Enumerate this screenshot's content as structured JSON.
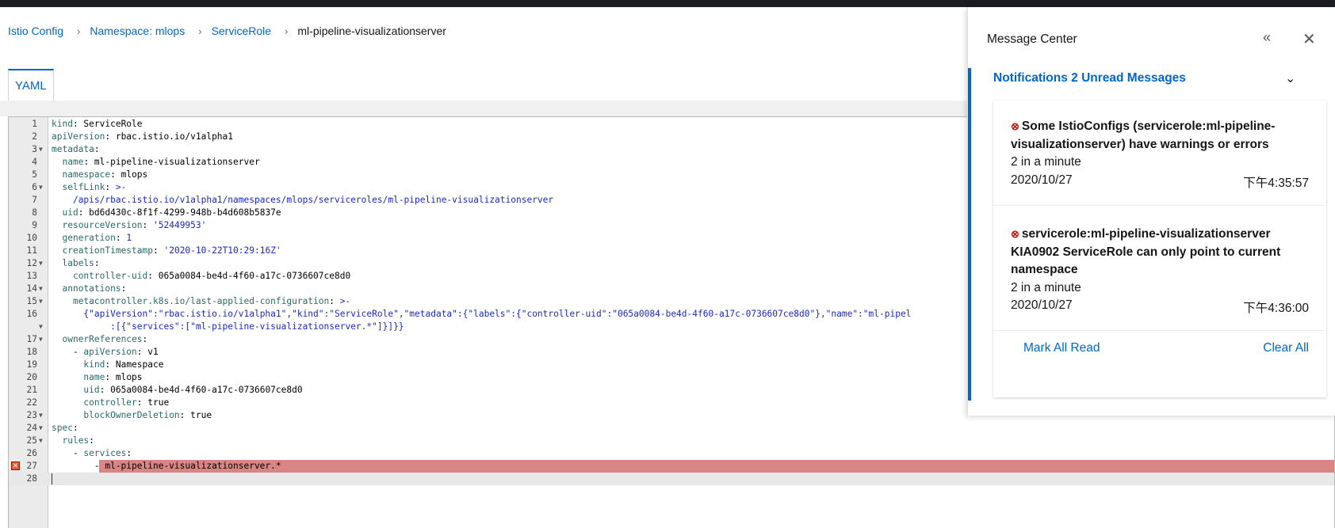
{
  "breadcrumb": {
    "items": [
      "Istio Config",
      "Namespace: mlops",
      "ServiceRole"
    ],
    "current": "ml-pipeline-visualizationserver",
    "separator": "›"
  },
  "tabs": [
    {
      "label": "YAML"
    }
  ],
  "editor": {
    "lines": [
      [
        {
          "t": "kind",
          "c": "k"
        },
        {
          "t": ": ServiceRole"
        }
      ],
      [
        {
          "t": "apiVersion",
          "c": "k"
        },
        {
          "t": ": rbac.istio.io/v1alpha1"
        }
      ],
      [
        {
          "t": "metadata",
          "c": "k"
        },
        {
          "t": ":"
        }
      ],
      [
        {
          "t": "  "
        },
        {
          "t": "name",
          "c": "k"
        },
        {
          "t": ": ml-pipeline-visualizationserver"
        }
      ],
      [
        {
          "t": "  "
        },
        {
          "t": "namespace",
          "c": "k"
        },
        {
          "t": ": mlops"
        }
      ],
      [
        {
          "t": "  "
        },
        {
          "t": "selfLink",
          "c": "k"
        },
        {
          "t": ": "
        },
        {
          "t": ">-",
          "c": "s"
        }
      ],
      [
        {
          "t": "    "
        },
        {
          "t": "/apis/rbac.istio.io/v1alpha1/namespaces/mlops/serviceroles/ml-pipeline-visualizationserver",
          "c": "s"
        }
      ],
      [
        {
          "t": "  "
        },
        {
          "t": "uid",
          "c": "k"
        },
        {
          "t": ": bd6d430c-8f1f-4299-948b-b4d608b5837e"
        }
      ],
      [
        {
          "t": "  "
        },
        {
          "t": "resourceVersion",
          "c": "k"
        },
        {
          "t": ": "
        },
        {
          "t": "'52449953'",
          "c": "s"
        }
      ],
      [
        {
          "t": "  "
        },
        {
          "t": "generation",
          "c": "k"
        },
        {
          "t": ": "
        },
        {
          "t": "1",
          "c": "n"
        }
      ],
      [
        {
          "t": "  "
        },
        {
          "t": "creationTimestamp",
          "c": "k"
        },
        {
          "t": ": "
        },
        {
          "t": "'2020-10-22T10:29:16Z'",
          "c": "s"
        }
      ],
      [
        {
          "t": "  "
        },
        {
          "t": "labels",
          "c": "k"
        },
        {
          "t": ":"
        }
      ],
      [
        {
          "t": "    "
        },
        {
          "t": "controller-uid",
          "c": "k"
        },
        {
          "t": ": 065a0084-be4d-4f60-a17c-0736607ce8d0"
        }
      ],
      [
        {
          "t": "  "
        },
        {
          "t": "annotations",
          "c": "k"
        },
        {
          "t": ":"
        }
      ],
      [
        {
          "t": "    "
        },
        {
          "t": "metacontroller.k8s.io/last-applied-configuration",
          "c": "k"
        },
        {
          "t": ": "
        },
        {
          "t": ">-",
          "c": "s"
        }
      ],
      [
        {
          "t": "      "
        },
        {
          "t": "{\"apiVersion\":\"rbac.istio.io/v1alpha1\",\"kind\":\"ServiceRole\",\"metadata\":{\"labels\":{\"controller-uid\":\"065a0084-be4d-4f60-a17c-0736607ce8d0\"},\"name\":\"ml-pipel",
          "c": "s"
        }
      ],
      [
        {
          "t": "           "
        },
        {
          "t": ":[{\"services\":[\"ml-pipeline-visualizationserver.*\"]}]}}",
          "c": "s"
        }
      ],
      [
        {
          "t": "  "
        },
        {
          "t": "ownerReferences",
          "c": "k"
        },
        {
          "t": ":"
        }
      ],
      [
        {
          "t": "    - "
        },
        {
          "t": "apiVersion",
          "c": "k"
        },
        {
          "t": ": v1"
        }
      ],
      [
        {
          "t": "      "
        },
        {
          "t": "kind",
          "c": "k"
        },
        {
          "t": ": Namespace"
        }
      ],
      [
        {
          "t": "      "
        },
        {
          "t": "name",
          "c": "k"
        },
        {
          "t": ": mlops"
        }
      ],
      [
        {
          "t": "      "
        },
        {
          "t": "uid",
          "c": "k"
        },
        {
          "t": ": 065a0084-be4d-4f60-a17c-0736607ce8d0"
        }
      ],
      [
        {
          "t": "      "
        },
        {
          "t": "controller",
          "c": "k"
        },
        {
          "t": ": true"
        }
      ],
      [
        {
          "t": "      "
        },
        {
          "t": "blockOwnerDeletion",
          "c": "k"
        },
        {
          "t": ": true"
        }
      ],
      [
        {
          "t": "spec",
          "c": "k"
        },
        {
          "t": ":"
        }
      ],
      [
        {
          "t": "  "
        },
        {
          "t": "rules",
          "c": "k"
        },
        {
          "t": ":"
        }
      ],
      [
        {
          "t": "    - "
        },
        {
          "t": "services",
          "c": "k"
        },
        {
          "t": ":"
        }
      ],
      [
        {
          "t": "        - ml-pipeline-visualizationserver.*"
        }
      ],
      []
    ],
    "fold_lines": [
      3,
      6,
      12,
      14,
      15,
      17,
      18,
      24,
      25,
      26
    ],
    "continuation_lines": [
      17
    ],
    "error_line": 28,
    "active_line": 29,
    "error_icon": "error-marker-icon",
    "fold_icon": "fold-arrow-icon"
  },
  "message_center": {
    "title": "Message Center",
    "collapse_icon": "double-chevron-left-icon",
    "collapse_glyph": "«",
    "close_icon": "close-icon",
    "close_glyph": "✕",
    "notifications_label": "Notifications 2 Unread Messages",
    "chevron_glyph": "⌄",
    "messages": [
      {
        "text": "Some IstioConfigs (servicerole:ml-pipeline-visualizationserver) have warnings or errors",
        "count": "2 in a minute",
        "date": "2020/10/27",
        "time": "下午4:35:57",
        "icon": "error-circle-icon",
        "icon_glyph": "⊗"
      },
      {
        "text": "servicerole:ml-pipeline-visualizationserver KIA0902 ServiceRole can only point to current namespace",
        "count": "2 in a minute",
        "date": "2020/10/27",
        "time": "下午4:36:00",
        "icon": "error-circle-icon",
        "icon_glyph": "⊗"
      }
    ],
    "mark_all_read": "Mark All Read",
    "clear_all": "Clear All"
  },
  "colors": {
    "link": "#0066cc",
    "error_line_bg": "#d98585",
    "error_icon": "#c9190b",
    "top_bar": "#1b1d21"
  }
}
